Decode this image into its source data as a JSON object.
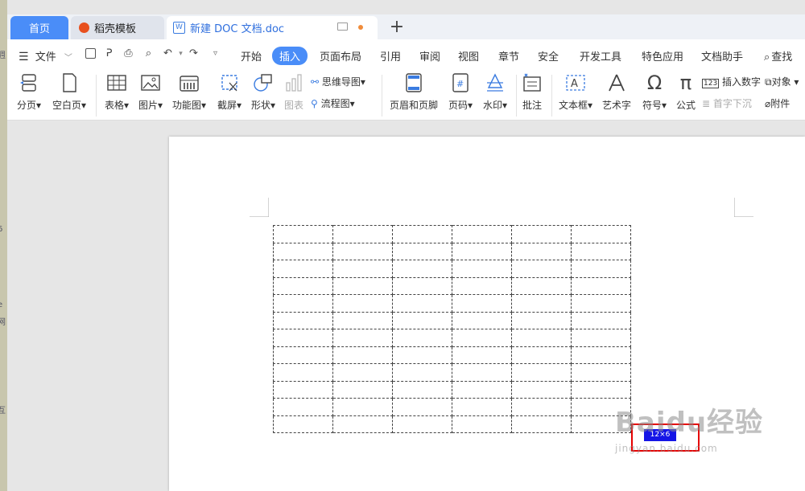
{
  "tabs": {
    "home": "首页",
    "templates": "稻壳模板",
    "document": "新建 DOC 文档.doc",
    "add": "+"
  },
  "left_strip": [
    "週",
    "6",
    "网",
    "e",
    "互"
  ],
  "menu": {
    "file": "文件",
    "items": [
      {
        "key": "start",
        "label": "开始"
      },
      {
        "key": "insert",
        "label": "插入"
      },
      {
        "key": "layout",
        "label": "页面布局"
      },
      {
        "key": "reference",
        "label": "引用"
      },
      {
        "key": "review",
        "label": "审阅"
      },
      {
        "key": "view",
        "label": "视图"
      },
      {
        "key": "section",
        "label": "章节"
      },
      {
        "key": "security",
        "label": "安全"
      },
      {
        "key": "devtools",
        "label": "开发工具"
      },
      {
        "key": "special",
        "label": "特色应用"
      },
      {
        "key": "docassist",
        "label": "文档助手"
      }
    ],
    "search": "查找",
    "active": "插入"
  },
  "ribbon": {
    "page_break": "分页",
    "blank_page": "空白页",
    "table": "表格",
    "picture": "图片",
    "function_chart": "功能图",
    "screenshot": "截屏",
    "shape": "形状",
    "chart": "图表",
    "mindmap": "思维导图",
    "flowchart": "流程图",
    "header_footer": "页眉和页脚",
    "page_number": "页码",
    "watermark": "水印",
    "comment": "批注",
    "textbox": "文本框",
    "wordart": "艺术字",
    "symbol": "符号",
    "formula": "公式",
    "insert_number": "插入数字",
    "object": "对象",
    "drop_cap": "首字下沉",
    "attachment": "附件"
  },
  "document": {
    "table_rows": 12,
    "table_cols": 6,
    "table_size_label": "12×6"
  },
  "watermark": {
    "line1": "Baidu经验",
    "line2": "jingyan.baidu.com"
  },
  "colors": {
    "accent": "#4a8df8",
    "badge_border": "#e60000",
    "badge_fill": "#1515e6"
  }
}
